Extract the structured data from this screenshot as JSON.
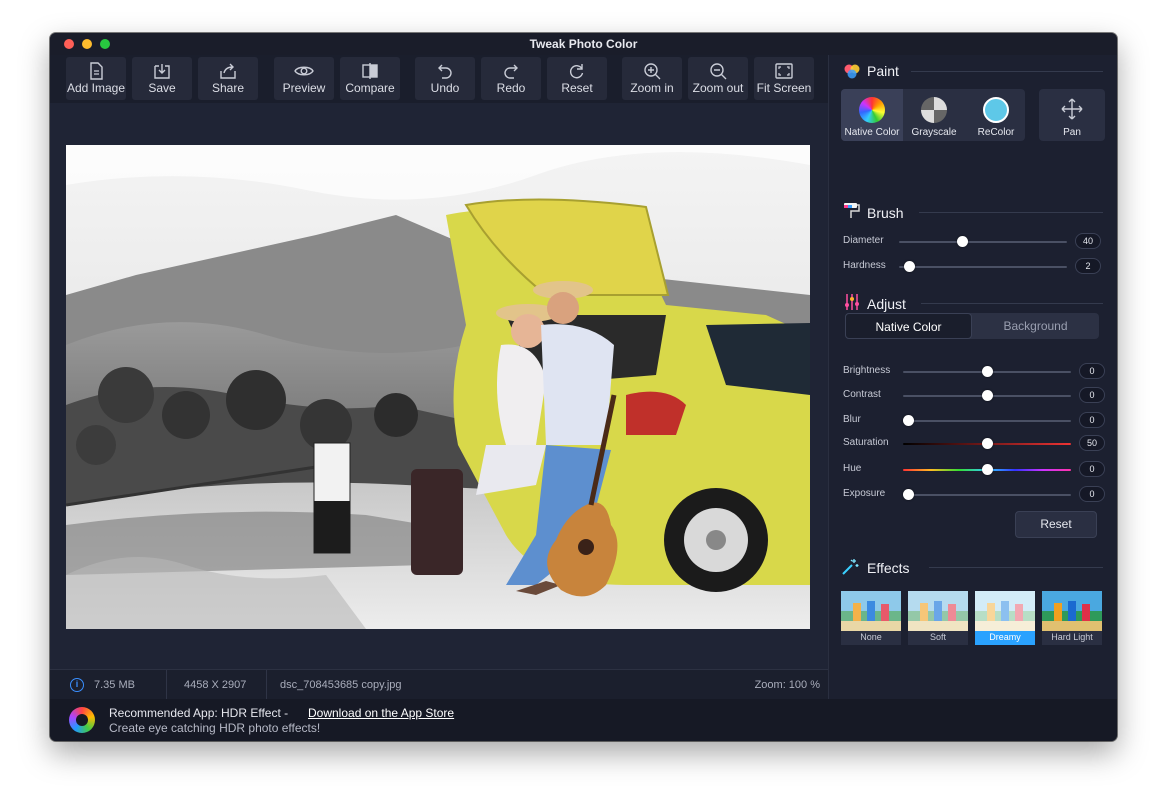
{
  "window": {
    "title": "Tweak Photo Color"
  },
  "toolbar": {
    "add_image": "Add Image",
    "save": "Save",
    "share": "Share",
    "preview": "Preview",
    "compare": "Compare",
    "undo": "Undo",
    "redo": "Redo",
    "reset": "Reset",
    "zoom_in": "Zoom in",
    "zoom_out": "Zoom out",
    "fit_screen": "Fit Screen"
  },
  "status": {
    "size": "7.35 MB",
    "dimensions": "4458 X 2907",
    "filename": "dsc_708453685 copy.jpg",
    "zoom": "Zoom: 100 %"
  },
  "promo": {
    "recommended": "Recommended App:",
    "app_name": "HDR Effect -",
    "link": "Download on the App Store",
    "tagline": "Create eye catching HDR photo effects!"
  },
  "paint": {
    "title": "Paint",
    "native_color": "Native Color",
    "grayscale": "Grayscale",
    "recolor": "ReColor",
    "pan": "Pan",
    "recolor_swatch": "#5ec8e8"
  },
  "brush": {
    "title": "Brush",
    "diameter_label": "Diameter",
    "diameter_value": "40",
    "hardness_label": "Hardness",
    "hardness_value": "2"
  },
  "adjust": {
    "title": "Adjust",
    "tab_native": "Native Color",
    "tab_background": "Background",
    "brightness_label": "Brightness",
    "brightness_value": "0",
    "contrast_label": "Contrast",
    "contrast_value": "0",
    "blur_label": "Blur",
    "blur_value": "0",
    "saturation_label": "Saturation",
    "saturation_value": "50",
    "hue_label": "Hue",
    "hue_value": "0",
    "exposure_label": "Exposure",
    "exposure_value": "0",
    "reset": "Reset"
  },
  "effects": {
    "title": "Effects",
    "none": "None",
    "soft": "Soft",
    "dreamy": "Dreamy",
    "hard_light": "Hard Light"
  }
}
